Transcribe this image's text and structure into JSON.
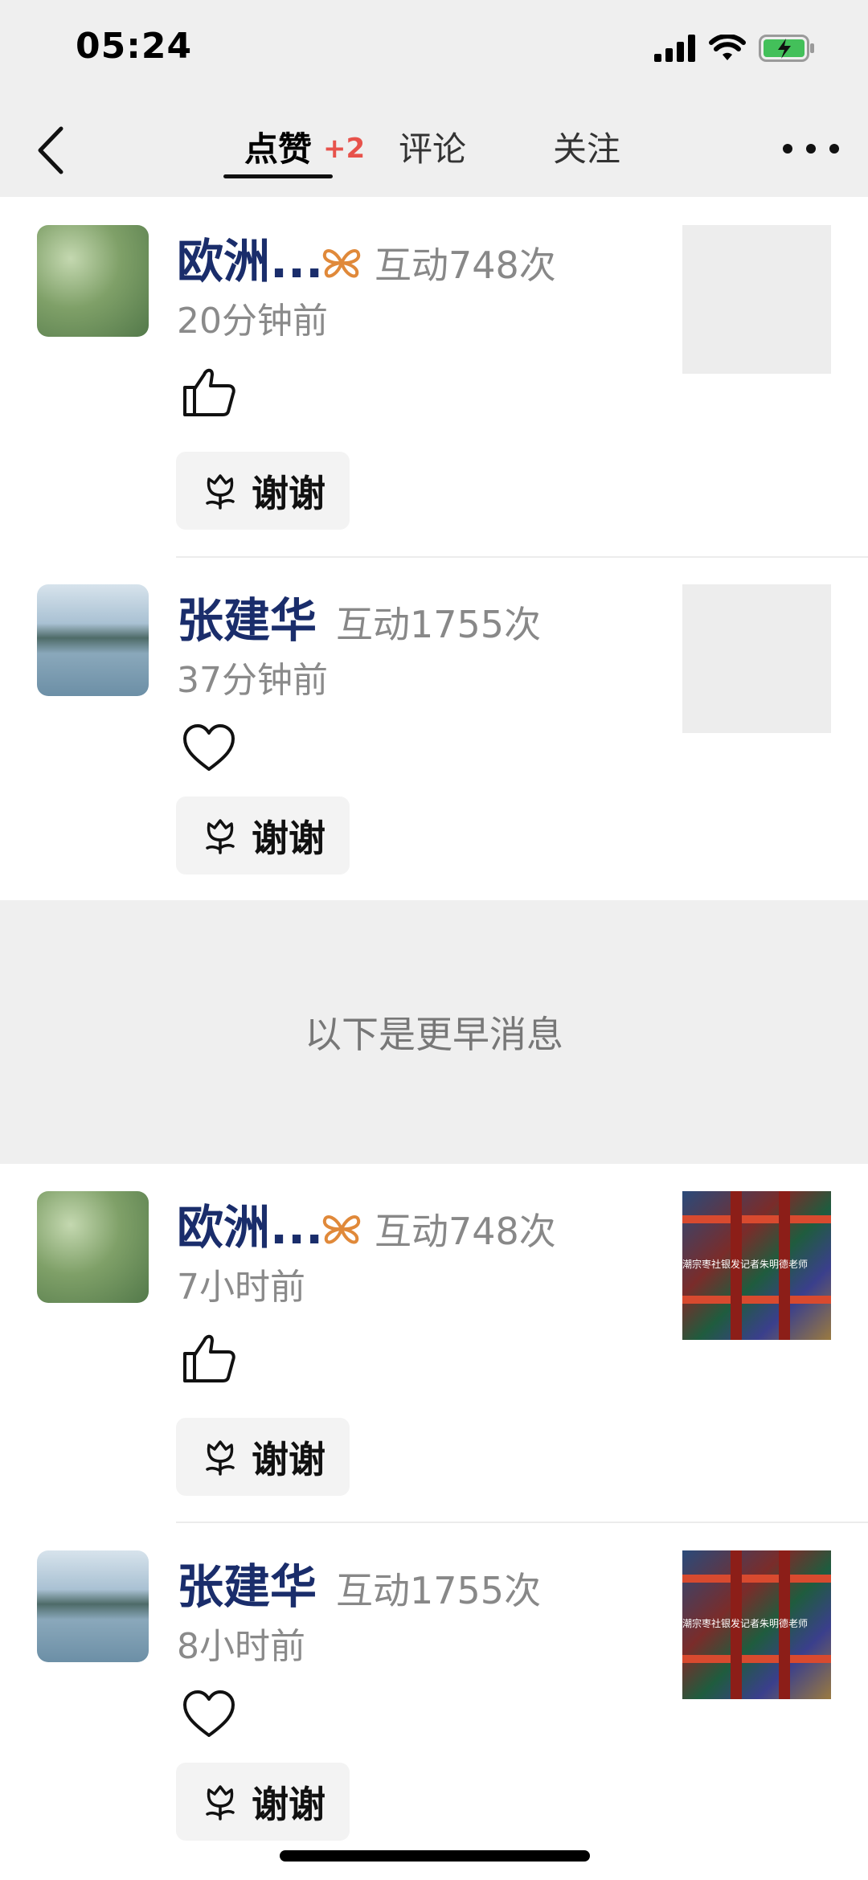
{
  "status_bar": {
    "time": "05:24"
  },
  "nav": {
    "tabs": [
      {
        "label": "点赞",
        "badge": "+2",
        "active": true
      },
      {
        "label": "评论"
      },
      {
        "label": "关注"
      }
    ]
  },
  "items": [
    {
      "username": "欧洲...",
      "interaction": "互动748次",
      "time": "20分钟前",
      "reaction": "thumbs-up-icon",
      "thanks": "谢谢",
      "thumbnail": "empty"
    },
    {
      "username": "张建华",
      "interaction": "互动1755次",
      "time": "37分钟前",
      "reaction": "heart-icon",
      "thanks": "谢谢",
      "thumbnail": "empty"
    },
    {
      "username": "欧洲...",
      "interaction": "互动748次",
      "time": "7小时前",
      "reaction": "thumbs-up-icon",
      "thanks": "谢谢",
      "thumbnail": "temple",
      "thumbnail_caption": "潮宗枣社银发记者朱明德老师"
    },
    {
      "username": "张建华",
      "interaction": "互动1755次",
      "time": "8小时前",
      "reaction": "heart-icon",
      "thanks": "谢谢",
      "thumbnail": "temple",
      "thumbnail_caption": "潮宗枣社银发记者朱明德老师"
    }
  ],
  "separator": {
    "label": "以下是更早消息"
  },
  "colors": {
    "username": "#1a2d6b",
    "badge": "#e7524b",
    "butterfly": "#e0893a"
  }
}
